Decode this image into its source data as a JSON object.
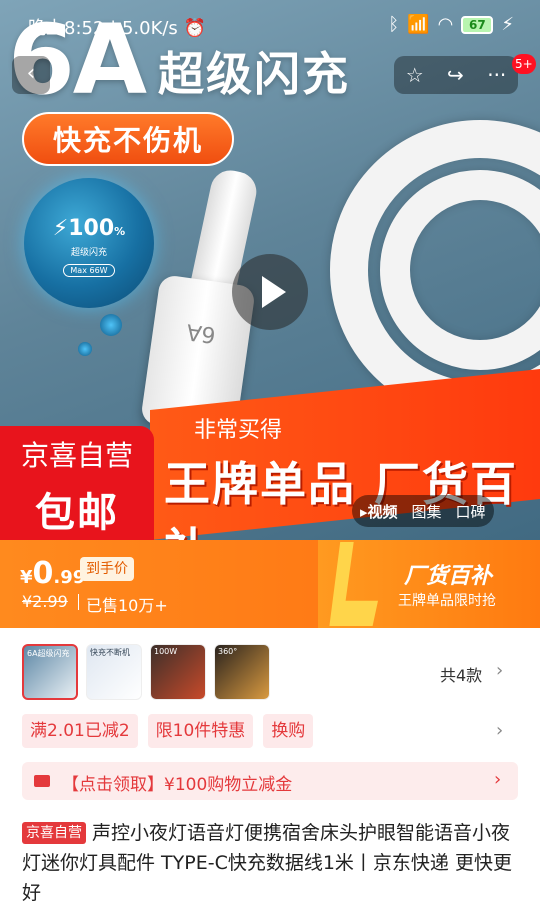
{
  "status_bar": {
    "time": "晚上8:52",
    "speed": "5.0K/s",
    "battery": "67"
  },
  "hero": {
    "big_title": "6A",
    "big_subtitle": "超级闪充",
    "pill": "快充不伤机",
    "bubble_percent": "100",
    "bubble_percent_unit": "%",
    "bubble_label": "超级闪充",
    "bubble_max": "Max 66W",
    "connector_mark": "6A",
    "banner_hint": "非常买得",
    "banner_text": "王牌单品 厂货百补",
    "jx_line1": "京喜自营",
    "jx_line2": "包邮",
    "media_tabs": [
      "▸视频",
      "图集",
      "口碑"
    ]
  },
  "nav": {
    "back_icon": "‹",
    "star_icon": "☆",
    "share_icon": "↪",
    "more_icon": "···",
    "badge": "5+"
  },
  "price": {
    "currency": "¥",
    "integer": "0",
    "decimal": ".99",
    "tag": "到手价",
    "original": "¥2.99",
    "sold": "已售10万+",
    "promo_title": "厂货百补",
    "promo_sub": "王牌单品限时抢"
  },
  "variants": {
    "thumbs": [
      {
        "label": "6A超级闪充"
      },
      {
        "label": "快充不断机"
      },
      {
        "label": "100W"
      },
      {
        "label": "360°"
      }
    ],
    "total": "共4款"
  },
  "chips": [
    "满2.01已减2",
    "限10件特惠",
    "换购"
  ],
  "coupon": "【点击领取】¥100购物立减金",
  "product": {
    "tag": "京喜自营",
    "title": "声控小夜灯语音灯便携宿舍床头护眼智能语音小夜灯迷你灯具配件 TYPE-C快充数据线1米丨京东快递 更快更好"
  },
  "colors": {
    "brand_red": "#e4393c",
    "promo_orange": "#ff7a10"
  }
}
